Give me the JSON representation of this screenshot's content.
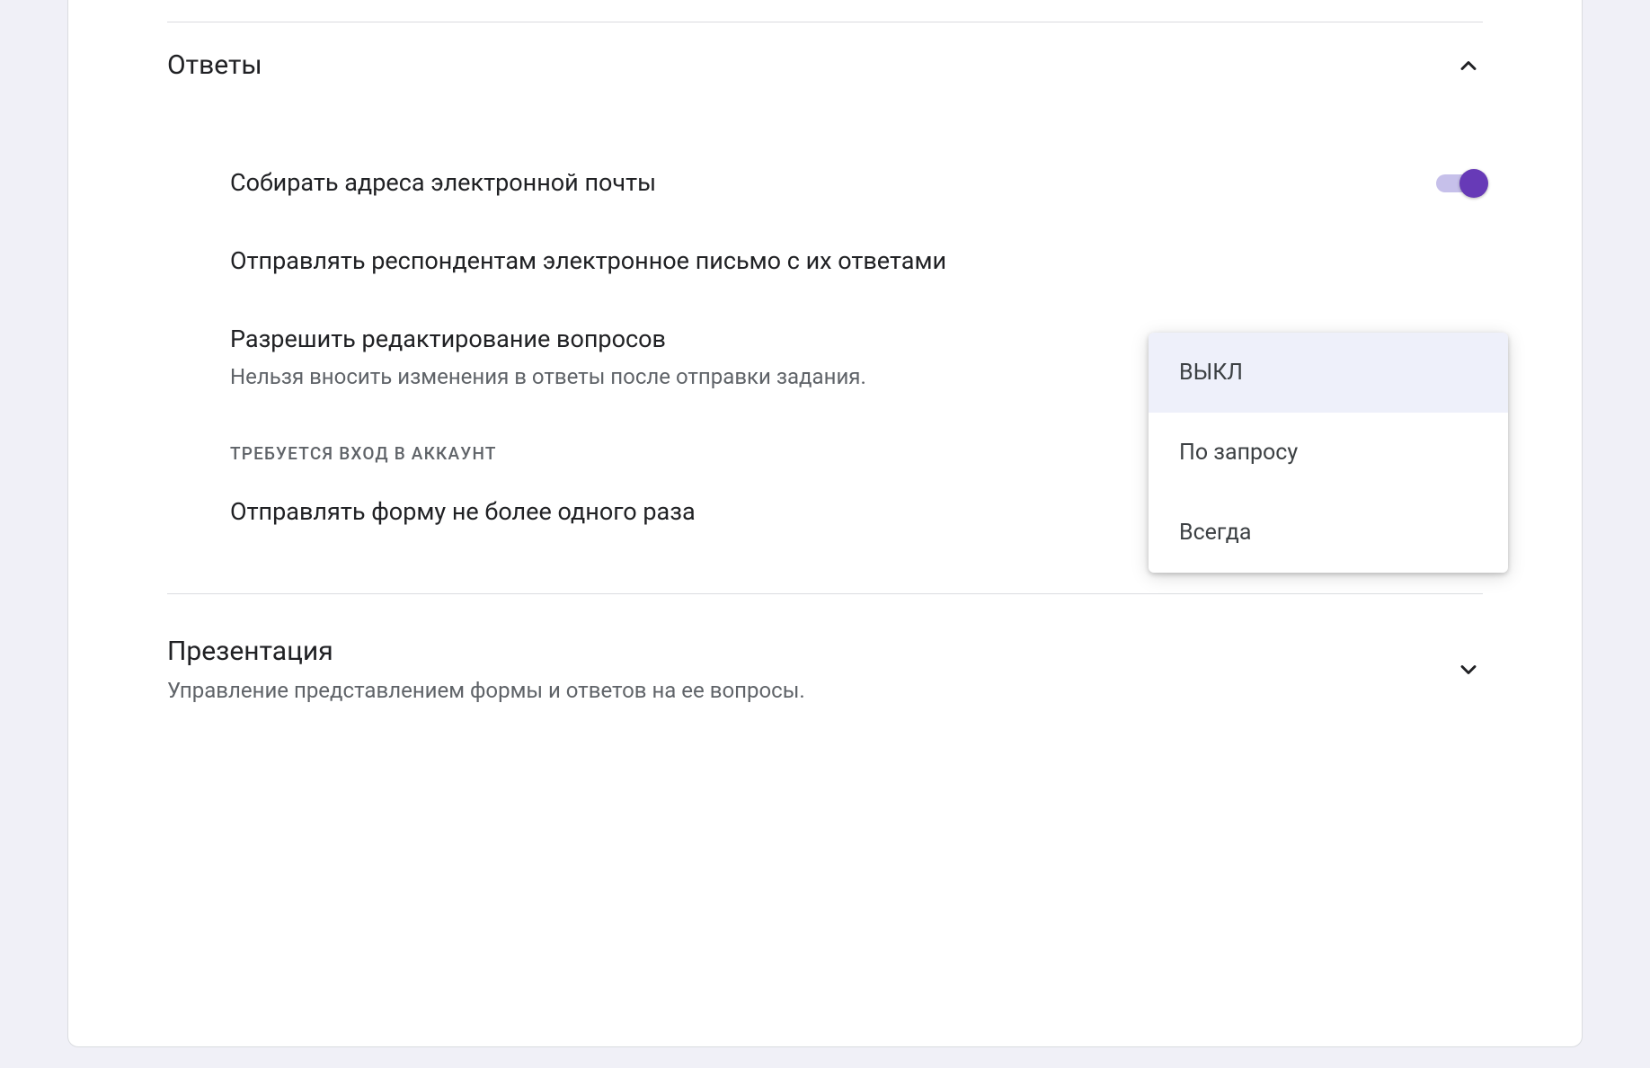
{
  "sections": {
    "answers": {
      "title": "Ответы",
      "expanded": true,
      "settings": {
        "collect_email": {
          "label": "Собирать адреса электронной почты",
          "toggle_state": "on"
        },
        "send_copy": {
          "label": "Отправлять респондентам электронное письмо с их ответами",
          "dropdown_options": [
            {
              "label": "ВЫКЛ",
              "selected": true
            },
            {
              "label": "По запросу",
              "selected": false
            },
            {
              "label": "Всегда",
              "selected": false
            }
          ]
        },
        "allow_edit": {
          "label": "Разрешить редактирование вопросов",
          "description": "Нельзя вносить изменения в ответы после отправки задания."
        },
        "login_required_header": "ТРЕБУЕТСЯ ВХОД В АККАУНТ",
        "limit_one": {
          "label": "Отправлять форму не более одного раза",
          "toggle_state": "off"
        }
      }
    },
    "presentation": {
      "title": "Презентация",
      "subtitle": "Управление представлением формы и ответов на ее вопросы.",
      "expanded": false
    }
  }
}
